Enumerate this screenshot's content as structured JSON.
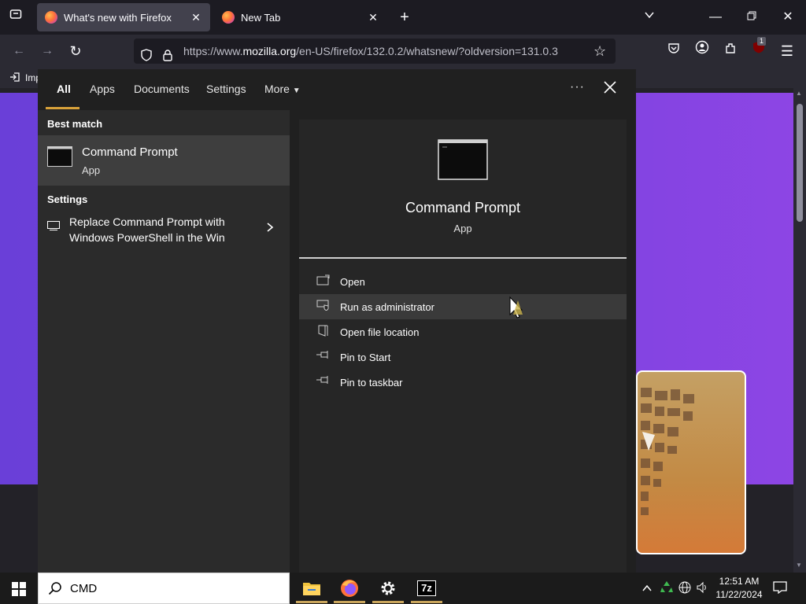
{
  "browser": {
    "tabs": [
      {
        "title": "What's new with Firefox",
        "active": true
      },
      {
        "title": "New Tab",
        "active": false
      }
    ],
    "url": {
      "prefix": "https://www.",
      "domain": "mozilla.org",
      "path": "/en-US/firefox/132.0.2/whatsnew/?oldversion=131.0.3"
    },
    "bookmarks_item": "Imp",
    "extension_badge": "1"
  },
  "search": {
    "filters": [
      "All",
      "Apps",
      "Documents",
      "Settings",
      "More"
    ],
    "active_filter": "All",
    "best_match_heading": "Best match",
    "best_match": {
      "title": "Command Prompt",
      "subtitle": "App"
    },
    "settings_heading": "Settings",
    "settings_result": {
      "line1": "Replace Command Prompt with",
      "line2": "Windows PowerShell in the Win"
    },
    "preview": {
      "title": "Command Prompt",
      "subtitle": "App"
    },
    "actions": [
      {
        "label": "Open",
        "icon": "open-icon"
      },
      {
        "label": "Run as administrator",
        "icon": "shield-icon"
      },
      {
        "label": "Open file location",
        "icon": "folder-icon"
      },
      {
        "label": "Pin to Start",
        "icon": "pin-icon"
      },
      {
        "label": "Pin to taskbar",
        "icon": "pin-icon"
      }
    ],
    "query": "CMD"
  },
  "taskbar": {
    "time": "12:51 AM",
    "date": "11/22/2024",
    "apps": [
      "file-explorer",
      "firefox",
      "settings",
      "7-zip"
    ],
    "app_7z_label": "7z"
  },
  "colors": {
    "accent": "#d8a23a",
    "purple": "#7a43e0"
  }
}
